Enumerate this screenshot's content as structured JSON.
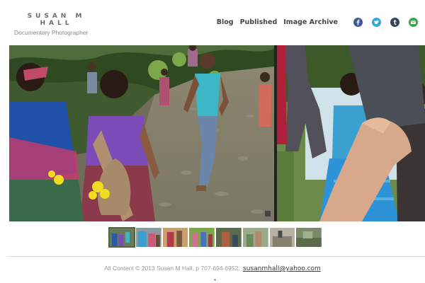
{
  "brand": {
    "name_line1": "SUSAN M",
    "name_line2": "HALL",
    "tagline": "Documentary Photographer"
  },
  "nav": {
    "items": [
      {
        "label": "Blog"
      },
      {
        "label": "Published"
      },
      {
        "label": "Image Archive"
      }
    ],
    "social": [
      {
        "icon": "facebook-icon",
        "color": "#3b5998"
      },
      {
        "icon": "twitter-icon",
        "color": "#33a7d8"
      },
      {
        "icon": "tumblr-icon",
        "color": "#34465d"
      },
      {
        "icon": "email-icon",
        "color": "#3aa34a"
      }
    ]
  },
  "slideshow": {
    "main_photo_icon": "photo-children-running-icon",
    "side_photo_icon": "photo-girl-in-blue-icon",
    "fullscreen_icon": "fullscreen-icon",
    "thumbnails": [
      {
        "active": true
      },
      {
        "active": false
      },
      {
        "active": false
      },
      {
        "active": false
      },
      {
        "active": false
      },
      {
        "active": false
      },
      {
        "active": false
      },
      {
        "active": false
      }
    ]
  },
  "footer": {
    "copyright": "All Content © 2013 Susan M Hall, p 707-694-6952,",
    "email": "susanmhall@yahoo.com"
  }
}
